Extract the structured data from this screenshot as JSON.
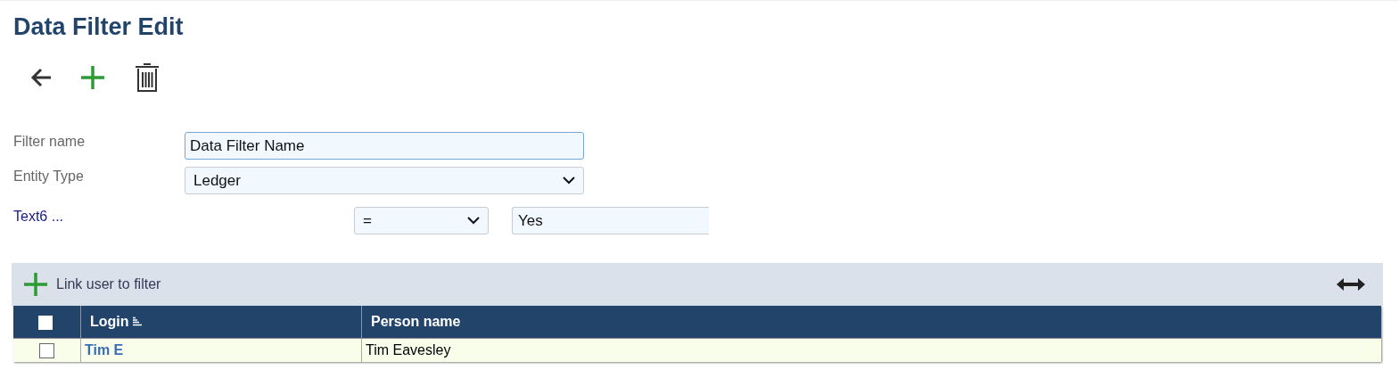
{
  "title": "Data Filter Edit",
  "form": {
    "filter_name": {
      "label": "Filter name",
      "value": "Data Filter Name"
    },
    "entity_type": {
      "label": "Entity Type",
      "value": "Ledger"
    },
    "condition": {
      "label": "Text6 ...",
      "operator": "=",
      "value": "Yes"
    }
  },
  "panel": {
    "link_button": "Link user to filter"
  },
  "table": {
    "select_all": {
      "checked": false
    },
    "columns": [
      {
        "label": "Login",
        "sorted": true
      },
      {
        "label": "Person name",
        "sorted": false
      }
    ],
    "rows": [
      {
        "checked": false,
        "login": "Tim E",
        "person_name": "Tim Eavesley"
      }
    ]
  }
}
